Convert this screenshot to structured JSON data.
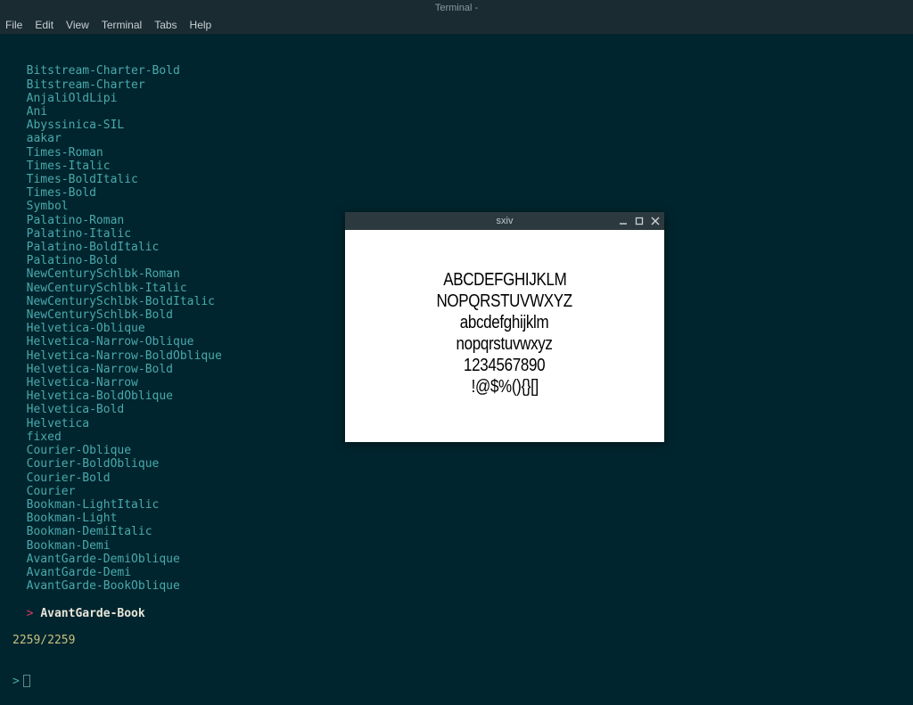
{
  "window": {
    "title": "Terminal -"
  },
  "menu": {
    "file": "File",
    "edit": "Edit",
    "view": "View",
    "terminal": "Terminal",
    "tabs": "Tabs",
    "help": "Help"
  },
  "fontlist": [
    "Bitstream-Charter-Bold",
    "Bitstream-Charter",
    "AnjaliOldLipi",
    "Ani",
    "Abyssinica-SIL",
    "aakar",
    "Times-Roman",
    "Times-Italic",
    "Times-BoldItalic",
    "Times-Bold",
    "Symbol",
    "Palatino-Roman",
    "Palatino-Italic",
    "Palatino-BoldItalic",
    "Palatino-Bold",
    "NewCenturySchlbk-Roman",
    "NewCenturySchlbk-Italic",
    "NewCenturySchlbk-BoldItalic",
    "NewCenturySchlbk-Bold",
    "Helvetica-Oblique",
    "Helvetica-Narrow-Oblique",
    "Helvetica-Narrow-BoldOblique",
    "Helvetica-Narrow-Bold",
    "Helvetica-Narrow",
    "Helvetica-BoldOblique",
    "Helvetica-Bold",
    "Helvetica",
    "fixed",
    "Courier-Oblique",
    "Courier-BoldOblique",
    "Courier-Bold",
    "Courier",
    "Bookman-LightItalic",
    "Bookman-Light",
    "Bookman-DemiItalic",
    "Bookman-Demi",
    "AvantGarde-DemiOblique",
    "AvantGarde-Demi",
    "AvantGarde-BookOblique"
  ],
  "selected": {
    "marker": ">",
    "name": "AvantGarde-Book"
  },
  "status": "2259/2259",
  "prompt": ">",
  "sxiv": {
    "title": "sxiv",
    "lines": [
      "ABCDEFGHIJKLM",
      "NOPQRSTUVWXYZ",
      "abcdefghijklm",
      "nopqrstuvwxyz",
      "1234567890",
      "!@$%(){}[]"
    ]
  }
}
